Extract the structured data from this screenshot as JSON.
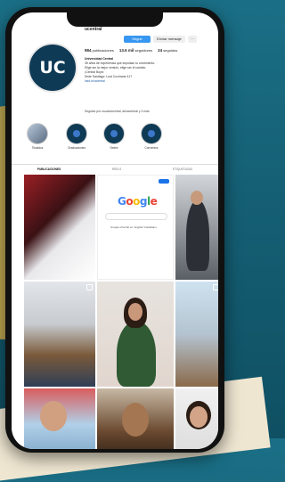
{
  "profile": {
    "username": "ucentral",
    "follow_label": "Seguir",
    "message_label": "Enviar mensaje",
    "more_label": "···",
    "avatar_text": "UC",
    "stats": {
      "posts": "984",
      "posts_label": "publicaciones",
      "followers": "13.6 mil",
      "followers_label": "seguidores",
      "following": "24",
      "following_label": "seguidos"
    },
    "bio": {
      "name": "Universidad Central",
      "line1": "35 años de experiencia que impulsan tu crecimiento.",
      "line2": "Elige ser la mejor versión, elige ser el cambio.",
      "line3": "¡Central Boys!",
      "line4": "Sede Santiago: Lord Cochrane 417",
      "link": "lnkd.in/ucentral"
    },
    "followed_by": "Seguido por usuariocentral, almacentral y 3 más"
  },
  "highlights": [
    {
      "label": "Titulados"
    },
    {
      "label": "Graduaciones"
    },
    {
      "label": "Sedes"
    },
    {
      "label": "Convenios"
    }
  ],
  "tabs": {
    "posts": "PUBLICACIONES",
    "reels": "REELS",
    "tagged": "ETIQUETADAS"
  },
  "google_post": {
    "logo": "Google",
    "caption": "Google ofrecido en: English Castellano"
  },
  "colors": {
    "accent": "#3897f0",
    "avatar_bg": "#0e3a55",
    "page_bg": "#1a6f86"
  }
}
